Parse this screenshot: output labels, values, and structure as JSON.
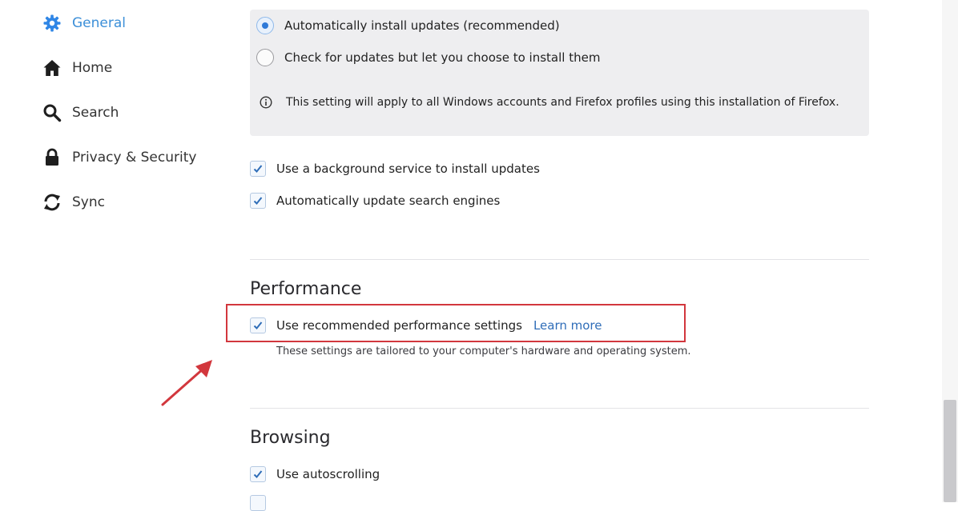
{
  "sidebar": {
    "items": [
      {
        "label": "General",
        "icon": "gear-icon"
      },
      {
        "label": "Home",
        "icon": "home-icon"
      },
      {
        "label": "Search",
        "icon": "search-icon"
      },
      {
        "label": "Privacy & Security",
        "icon": "lock-icon"
      },
      {
        "label": "Sync",
        "icon": "sync-icon"
      }
    ],
    "selected": "General",
    "accent_color": "#0a84ff"
  },
  "updates": {
    "options": [
      {
        "label": "Automatically install updates (recommended)",
        "checked": true
      },
      {
        "label": "Check for updates but let you choose to install them",
        "checked": false
      }
    ],
    "info_icon": "info-icon",
    "info_text": "This setting will apply to all Windows accounts and Firefox profiles using this installation of Firefox.",
    "checkboxes": [
      {
        "label": "Use a background service to install updates",
        "checked": true
      },
      {
        "label": "Automatically update search engines",
        "checked": true
      }
    ]
  },
  "performance": {
    "title": "Performance",
    "recommended_label": "Use recommended performance settings",
    "recommended_checked": true,
    "learn_more": "Learn more",
    "note": "These settings are tailored to your computer's hardware and operating system."
  },
  "browsing": {
    "title": "Browsing",
    "autoscroll_label": "Use autoscrolling",
    "autoscroll_checked": true
  },
  "annotation": {
    "highlight_color": "#d2373d"
  }
}
